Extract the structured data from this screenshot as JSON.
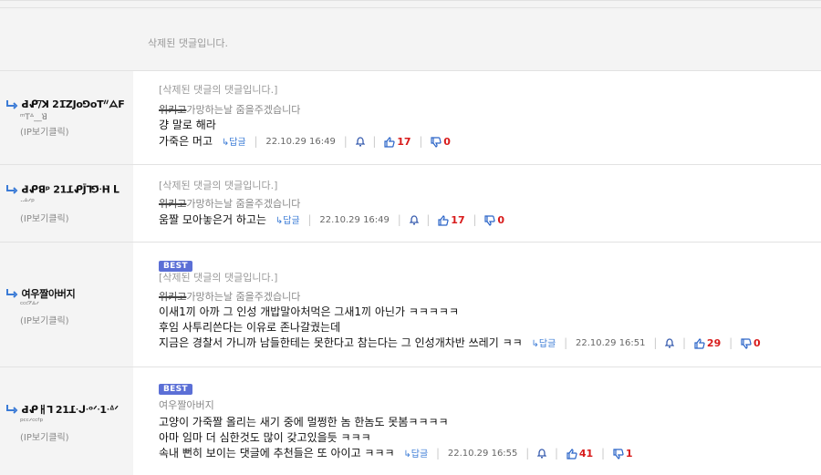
{
  "deleted_comment": "삭제된 댓글입니다.",
  "comments": [
    {
      "author": "ꓒ̄ᕵ̄/̅ꓘ 21̅ꓜ̄JoꓨoꓔᐥᗋF",
      "author_sub": "ᵐꓔᐞ__ꓤ̄",
      "ip": "(IP보기클릭)",
      "ref": "[삭제된 댓글의 댓글입니다.]",
      "mention_strike": "위키고",
      "mention_rest": "가망하는날 줌을주겠습니다",
      "lines": [
        "걍 말로 해라",
        "가죽은 머고"
      ],
      "reply": "답글",
      "date": "22.10.29 16:49",
      "up": "17",
      "down": "0",
      "best": ""
    },
    {
      "author": "ꓒ̄ᕵ̄ꓭᵖ 21ꓕ̄ᕵ̄J̄ꓶꓨ̄ᐧꓧ̄ ᒪ",
      "author_sub": "ᐧᐧᐞᐟᵖ",
      "ip": "(IP보기클릭)",
      "ref": "[삭제된 댓글의 댓글입니다.]",
      "mention_strike": "위키고",
      "mention_rest": "가망하는날 줌을주겠습니다",
      "lines": [
        "움짤 모아놓은거 하고는"
      ],
      "reply": "답글",
      "date": "22.10.29 16:49",
      "up": "17",
      "down": "0",
      "best": ""
    },
    {
      "author": "여우짤아버지",
      "author_sub": "ᶜᶜᶜᐟ̅ᐞᐟ",
      "ip": "(IP보기클릭)",
      "ref": "[삭제된 댓글의 댓글입니다.]",
      "mention_strike": "위키고",
      "mention_rest": "가망하는날 줌을주겠습니다",
      "lines": [
        "이새1끼 아까 그 인성 개밥말아처먹은 그새1끼 아닌가 ㅋㅋㅋㅋㅋ",
        "후임 사투리쓴다는 이유로 존나갈궜는데",
        "지금은 경찰서 가니까 남들한테는 못한다고 참는다는 그 인성개차반 쓰레기 ㅋㅋ"
      ],
      "reply": "답글",
      "date": "22.10.29 16:51",
      "up": "29",
      "down": "0",
      "best": "BEST"
    },
    {
      "author": "ꓒ̄ᕵ̄ㅐꓶ 21ꓕ̄ᐧᒍᐧᵒᐟᐧ1ᐧᐞᐟ",
      "author_sub": "ᵖᶜᶜᐟᶜᶜᶠᵖ",
      "ip": "(IP보기클릭)",
      "ref": "",
      "mention_strike": "",
      "mention_rest": "여우짤아버지",
      "lines": [
        "고양이 가죽짤 올리는 새기 중에 멀쩡한 놈 한놈도 못봄ㅋㅋㅋㅋ",
        "아마 임마 더 심한것도 많이 갖고있을듯 ㅋㅋㅋ",
        "속내 뻔히 보이는 댓글에 추천들은 또 아이고 ㅋㅋㅋ"
      ],
      "reply": "답글",
      "date": "22.10.29 16:55",
      "up": "41",
      "down": "1",
      "best": "BEST"
    }
  ]
}
